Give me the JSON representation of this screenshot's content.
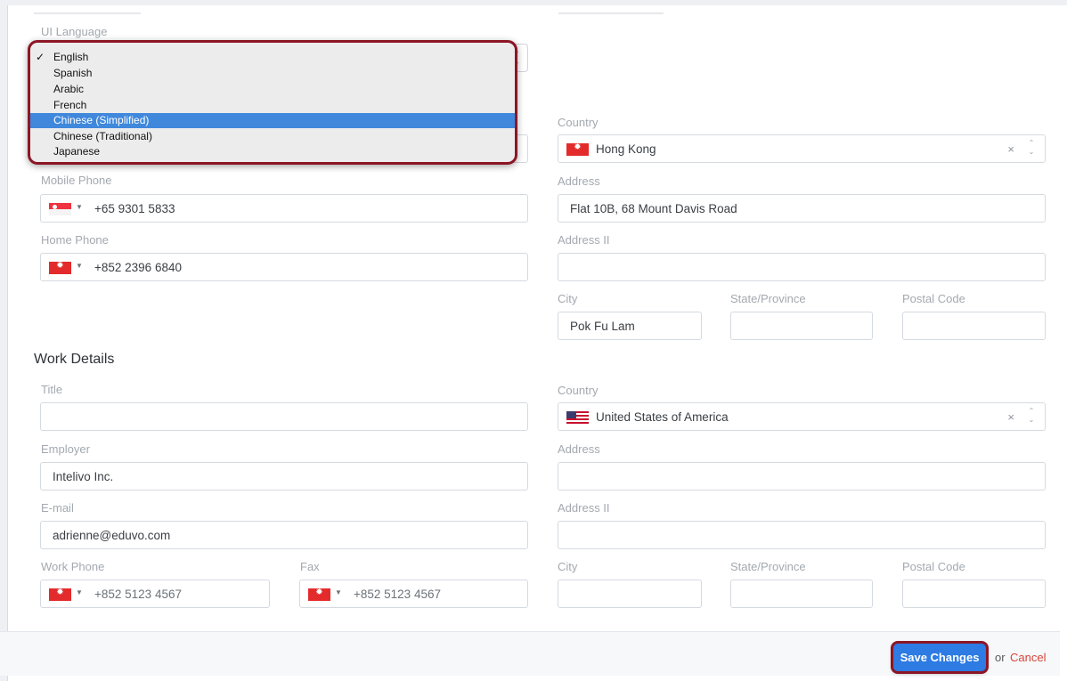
{
  "personal": {
    "ui_language_label": "UI Language",
    "language_options": [
      "English",
      "Spanish",
      "Arabic",
      "French",
      "Chinese (Simplified)",
      "Chinese (Traditional)",
      "Japanese"
    ],
    "selected_language": "English",
    "highlighted_option": "Chinese (Simplified)",
    "check_mark": "✓",
    "mobile_phone_label": "Mobile Phone",
    "mobile_phone_value": "+65 9301 5833",
    "home_phone_label": "Home Phone",
    "home_phone_value": "+852 2396 6840",
    "country_label": "Country",
    "country_value": "Hong Kong",
    "address_label": "Address",
    "address_value": "Flat 10B, 68 Mount Davis Road",
    "address2_label": "Address II",
    "address2_value": "",
    "city_label": "City",
    "city_value": "Pok Fu Lam",
    "state_label": "State/Province",
    "state_value": "",
    "postal_label": "Postal Code",
    "postal_value": ""
  },
  "work": {
    "section_title": "Work Details",
    "title_label": "Title",
    "title_value": "",
    "employer_label": "Employer",
    "employer_value": "Intelivo Inc.",
    "email_label": "E-mail",
    "email_value": "adrienne@eduvo.com",
    "work_phone_label": "Work Phone",
    "work_phone_value": "+852 5123 4567",
    "fax_label": "Fax",
    "fax_value": "+852 5123 4567",
    "country_label": "Country",
    "country_value": "United States of America",
    "address_label": "Address",
    "address_value": "",
    "address2_label": "Address II",
    "address2_value": "",
    "city_label": "City",
    "city_value": "",
    "state_label": "State/Province",
    "state_value": "",
    "postal_label": "Postal Code",
    "postal_value": ""
  },
  "glyphs": {
    "caret": "▼",
    "clear": "×",
    "spin_up": "⌃",
    "spin_down": "⌄"
  },
  "footer": {
    "save_label": "Save Changes",
    "or_text": "or",
    "cancel_label": "Cancel"
  },
  "colors": {
    "primary": "#2d7be3",
    "highlight": "#8c1625",
    "cancel": "#d9443a",
    "selected_option": "#3f88dc"
  },
  "icons": {
    "hk_flag": "hong-kong-flag-icon",
    "sg_flag": "singapore-flag-icon",
    "us_flag": "usa-flag-icon"
  }
}
